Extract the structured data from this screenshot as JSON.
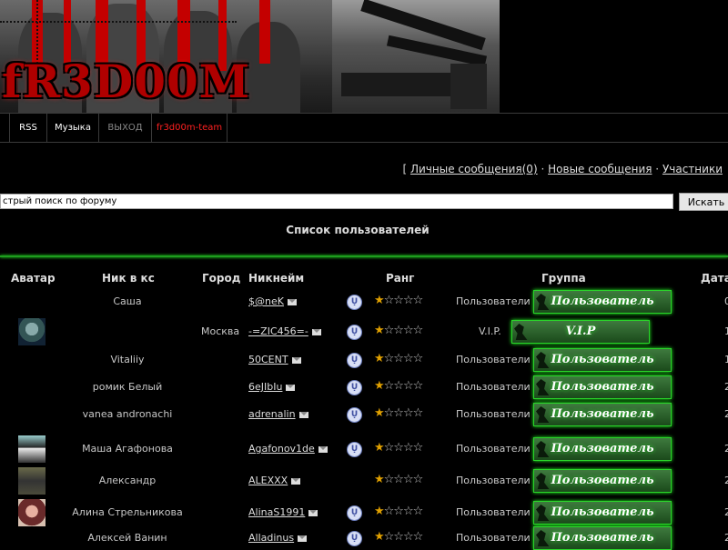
{
  "header": {
    "logo_text": "fR3D00M"
  },
  "nav": [
    {
      "label": "RSS",
      "color": "#ffffff"
    },
    {
      "label": "Музыка",
      "color": "#ffffff"
    },
    {
      "label": "ВЫХОД",
      "color": "#888888"
    },
    {
      "label": "fr3d00m-team",
      "color": "#ff2020"
    }
  ],
  "user_links": {
    "open": "[",
    "messages": "Личные сообщения(0)",
    "sep1": "·",
    "new_messages": "Новые сообщения",
    "sep2": "·",
    "members": "Участники"
  },
  "search": {
    "placeholder": "стрый поиск по форуму",
    "button": "Искать"
  },
  "list_title": "Список пользователей",
  "columns": [
    "Аватар",
    "Ник в кс",
    "Город",
    "Никнейм",
    "Ранг",
    "Группа",
    "Дата"
  ],
  "rows": [
    {
      "avatar": "",
      "cs_nick": "Саша",
      "city": "",
      "nickname": "$@neK",
      "group": "Пользователи",
      "badge": "Пользователь",
      "date": "0"
    },
    {
      "avatar": "robot-avatar",
      "cs_nick": "",
      "city": "Москва",
      "nickname": "-=ZIC456=-",
      "group": "V.I.P.",
      "badge": "V.I.P",
      "date": "1"
    },
    {
      "avatar": "",
      "cs_nick": "Vitaliiy",
      "city": "",
      "nickname": "50CENT",
      "group": "Пользователи",
      "badge": "Пользователь",
      "date": "1"
    },
    {
      "avatar": "",
      "cs_nick": "ромик Белый",
      "city": "",
      "nickname": "6eJIbIu",
      "group": "Пользователи",
      "badge": "Пользователь",
      "date": "2"
    },
    {
      "avatar": "",
      "cs_nick": "vanea andronachi",
      "city": "",
      "nickname": "adrenalin",
      "group": "Пользователи",
      "badge": "Пользователь",
      "date": "2"
    },
    {
      "avatar": "girl-avatar",
      "cs_nick": "Маша Агафонова",
      "city": "",
      "nickname": "Agafonov1de",
      "group": "Пользователи",
      "badge": "Пользователь",
      "date": "2"
    },
    {
      "avatar": "soldier-avatar",
      "cs_nick": "Александр",
      "city": "",
      "nickname": "ALEXXX",
      "group": "Пользователи",
      "badge": "Пользователь",
      "date": "2"
    },
    {
      "avatar": "woman-avatar",
      "cs_nick": "Алина Стрельникова",
      "city": "",
      "nickname": "AlinaS1991",
      "group": "Пользователи",
      "badge": "Пользователь",
      "date": "2"
    },
    {
      "avatar": "",
      "cs_nick": "Алексей Ванин",
      "city": "",
      "nickname": "Alladinus",
      "group": "Пользователи",
      "badge": "Пользователь",
      "date": "2"
    }
  ]
}
